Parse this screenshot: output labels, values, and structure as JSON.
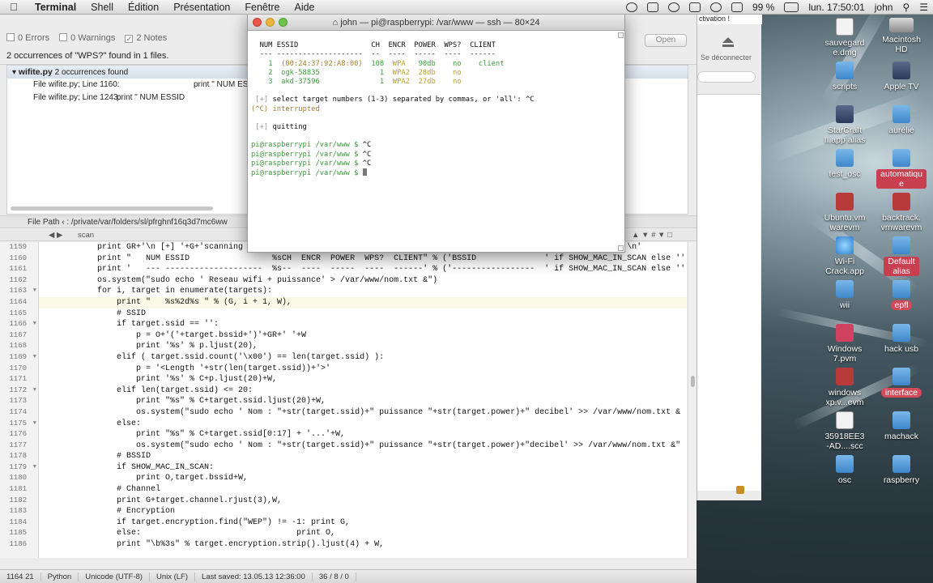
{
  "menubar": {
    "app": "Terminal",
    "items": [
      "Shell",
      "Édition",
      "Présentation",
      "Fenêtre",
      "Aide"
    ],
    "battery": "99 %",
    "clock": "lun. 17:50:01",
    "user": "john"
  },
  "editor": {
    "tabs": {
      "errors": "0 Errors",
      "warnings": "0 Warnings",
      "notes": "2 Notes"
    },
    "summary": "2 occurrences of \"WPS?\" found in 1 files.",
    "open_button": "Open",
    "results_group": {
      "file": "wifite.py",
      "count": "2 occurrences found"
    },
    "results": [
      {
        "label": "File wifite.py; Line 1160:",
        "snippet": "print \"    NUM ESSID"
      },
      {
        "label": "File wifite.py; Line 1243:",
        "snippet": "print \"  NUM ESSID"
      }
    ],
    "path": "File Path ‹ : /private/var/folders/sl/pfrghnf16q3d7mc6ww",
    "nav_scope": "scan",
    "line_numbers": [
      "1159",
      "1160",
      "1161",
      "1162",
      "1163",
      "1164",
      "1165",
      "1166",
      "1167",
      "1168",
      "1169",
      "1170",
      "1171",
      "1172",
      "1173",
      "1174",
      "1175",
      "1176",
      "1177",
      "1178",
      "1179",
      "1180",
      "1181",
      "1182",
      "1183",
      "1184",
      "1185",
      "1186"
    ],
    "code": [
      "            print GR+'\\n [+] '+G+'scanning '+W+'(' + iface+W+'), updates at 5 sec intervals, '+G+'CTRL+C'+W+' when ready.\\n'",
      "            print \"   NUM ESSID                 %sCH  ENCR  POWER  WPS?  CLIENT\" % ('BSSID              ' if SHOW_MAC_IN_SCAN else ''",
      "            print '   --- --------------------  %s--  ----  -----  ----  ------' % ('-----------------  ' if SHOW_MAC_IN_SCAN else ''",
      "            os.system(\"sudo echo ' Reseau wifi + puissance' > /var/www/nom.txt &\")",
      "            for i, target in enumerate(targets):",
      "                print \"   %s%2d%s \" % (G, i + 1, W),",
      "                # SSID",
      "                if target.ssid == '':",
      "                    p = O+'('+target.bssid+')'+GR+' '+W",
      "                    print '%s' % p.ljust(20),",
      "                elif ( target.ssid.count('\\x00') == len(target.ssid) ):",
      "                    p = '<Length '+str(len(target.ssid))+'>'",
      "                    print '%s' % C+p.ljust(20)+W,",
      "                elif len(target.ssid) <= 20:",
      "                    print \"%s\" % C+target.ssid.ljust(20)+W,",
      "                    os.system(\"sudo echo ' Nom : \"+str(target.ssid)+\" puissance \"+str(target.power)+\" decibel' >> /var/www/nom.txt &",
      "                else:",
      "                    print \"%s\" % C+target.ssid[0:17] + '...'+W,",
      "                    os.system(\"sudo echo ' Nom : \"+str(target.ssid)+\" puissance \"+str(target.power)+\"decibel' >> /var/www/nom.txt &\"",
      "                # BSSID",
      "                if SHOW_MAC_IN_SCAN:",
      "                    print O,target.bssid+W,",
      "                # Channel",
      "                print G+target.channel.rjust(3),W,",
      "                # Encryption",
      "                if target.encryption.find(\"WEP\") != -1: print G,",
      "                else:                                print O,",
      "                print \"\\b%3s\" % target.encryption.strip().ljust(4) + W,"
    ],
    "status": {
      "position": "1164  21",
      "language": "Python",
      "encoding": "Unicode (UTF-8)",
      "line_endings": "Unix (LF)",
      "saved": "Last saved: 13.05.13 12:36:00",
      "counts": "36 / 8 / 0"
    }
  },
  "side_window": {
    "top_note": "ctivation !",
    "disconnect": "Se déconnecter"
  },
  "terminal": {
    "title": "john — pi@raspberrypi: /var/www — ssh — 80×24",
    "header": "  NUM ESSID                 CH  ENCR  POWER  WPS?  CLIENT",
    "divider": "  --- --------------------  --  ----  -----  ----  ------",
    "rows": [
      {
        "num": "1",
        "essid": "(00:24:37:92:A8:00)",
        "ch": "108",
        "encr": "WPA",
        "power": "90db",
        "wps": "no",
        "client": "client"
      },
      {
        "num": "2",
        "essid": "ogk-58835",
        "ch": "1",
        "encr": "WPA2",
        "power": "28db",
        "wps": "no",
        "client": ""
      },
      {
        "num": "3",
        "essid": "akd-37596",
        "ch": "1",
        "encr": "WPA2",
        "power": "27db",
        "wps": "no",
        "client": ""
      }
    ],
    "select_prefix": " [+] ",
    "select_text": "select target numbers (1-3) separated by commas, or 'all': ^C",
    "interrupted": "(^C) interrupted",
    "quitting_prefix": " [+] ",
    "quitting": "quitting",
    "prompt": "pi@raspberrypi /var/www $ ",
    "history": [
      "^C",
      "^C",
      "^C",
      ""
    ]
  },
  "desktop": {
    "icons": [
      {
        "name": "sauvegarde.dmg",
        "label": "sauvegard\ne.dmg"
      },
      {
        "name": "macintosh-hd",
        "label": "Macintosh\nHD"
      },
      {
        "name": "scripts",
        "label": "scripts"
      },
      {
        "name": "apple-tv",
        "label": "Apple TV"
      },
      {
        "name": "starcraft",
        "label": "StarCraft\nII.app alias"
      },
      {
        "name": "aurelie",
        "label": "aurélie"
      },
      {
        "name": "test-osc",
        "label": "test_osc"
      },
      {
        "name": "automatique",
        "label": "automatiqu\ne"
      },
      {
        "name": "ubuntu",
        "label": "Ubuntu.vm\nwarevm"
      },
      {
        "name": "backtrack",
        "label": "backtrack.\nvmwarevm"
      },
      {
        "name": "wifi-crack",
        "label": "Wi-Fi\nCrack.app"
      },
      {
        "name": "default-alias",
        "label": "Default\nalias"
      },
      {
        "name": "wii",
        "label": "wii"
      },
      {
        "name": "epfl",
        "label": "epfl"
      },
      {
        "name": "windows7",
        "label": "Windows\n7.pvm"
      },
      {
        "name": "hack-usb",
        "label": "hack usb"
      },
      {
        "name": "windows-xp",
        "label": "windows\nxp.v...evm"
      },
      {
        "name": "interface",
        "label": "interface"
      },
      {
        "name": "scc-file",
        "label": "35918EE3\n-AD....scc"
      },
      {
        "name": "machack",
        "label": "machack"
      },
      {
        "name": "osc",
        "label": "osc"
      },
      {
        "name": "raspberry",
        "label": "raspberry"
      }
    ]
  }
}
